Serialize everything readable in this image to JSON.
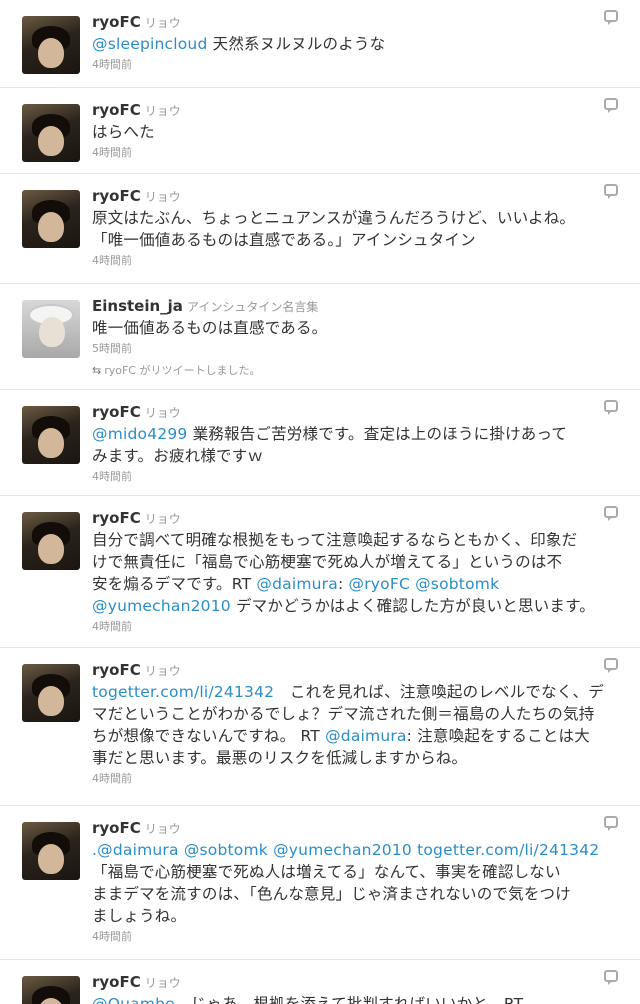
{
  "tweets": [
    {
      "user": "ryoFC",
      "name": "リョウ",
      "parts": [
        {
          "t": "@sleepincloud",
          "link": true
        },
        {
          "t": " 天然系ヌルヌルのような"
        }
      ],
      "time": "4時間前"
    },
    {
      "user": "ryoFC",
      "name": "リョウ",
      "parts": [
        {
          "t": "はらへた"
        }
      ],
      "time": "4時間前"
    },
    {
      "user": "ryoFC",
      "name": "リョウ",
      "parts": [
        {
          "t": "原文はたぶん、ちょっとニュアンスが違うんだろうけど、いいよね。\n「唯一価値あるものは直感である。」アインシュタイン"
        }
      ],
      "time": "4時間前"
    },
    {
      "user": "Einstein_ja",
      "name": "アインシュタイン名言集",
      "parts": [
        {
          "t": "唯一価値あるものは直感である。"
        }
      ],
      "time": "5時間前",
      "retweet": "ryoFC がリツイートしました。"
    },
    {
      "user": "ryoFC",
      "name": "リョウ",
      "parts": [
        {
          "t": "@mido4299",
          "link": true
        },
        {
          "t": " 業務報告ご苦労様です。査定は上のほうに掛けあって\nみます。お疲れ様ですｗ"
        }
      ],
      "time": "4時間前"
    },
    {
      "user": "ryoFC",
      "name": "リョウ",
      "parts": [
        {
          "t": "自分で調べて明確な根拠をもって注意喚起するならともかく、印象だ\nけで無責任に「福島で心筋梗塞で死ぬ人が増えてる」というのは不\n安を煽るデマです。RT "
        },
        {
          "t": "@daimura",
          "link": true
        },
        {
          "t": ": "
        },
        {
          "t": "@ryoFC",
          "link": true
        },
        {
          "t": " "
        },
        {
          "t": "@sobtomk",
          "link": true
        },
        {
          "t": "\n"
        },
        {
          "t": "@yumechan2010",
          "link": true
        },
        {
          "t": " デマかどうかはよく確認した方が良いと思います。"
        }
      ],
      "time": "4時間前"
    },
    {
      "user": "ryoFC",
      "name": "リョウ",
      "parts": [
        {
          "t": "togetter.com/li/241342",
          "link": true
        },
        {
          "t": "　これを見れば、注意喚起のレベルでなく、デ\nマだということがわかるでしょ？デマ流された側＝福島の人たちの気持\nちが想像できないんですね。 RT "
        },
        {
          "t": "@daimura",
          "link": true
        },
        {
          "t": ": 注意喚起をすることは大\n事だと思います。最悪のリスクを低減しますからね。"
        }
      ],
      "time": "4時間前"
    },
    {
      "user": "ryoFC",
      "name": "リョウ",
      "parts": [
        {
          "t": ".@daimura",
          "link": true
        },
        {
          "t": " "
        },
        {
          "t": "@sobtomk",
          "link": true
        },
        {
          "t": " "
        },
        {
          "t": "@yumechan2010",
          "link": true
        },
        {
          "t": " "
        },
        {
          "t": "togetter.com/li/241342",
          "link": true
        },
        {
          "t": "\n「福島で心筋梗塞で死ぬ人は増えてる」なんて、事実を確認しない\nままデマを流すのは、「色んな意見」じゃ済まされないので気をつけ\nましょうね。"
        }
      ],
      "time": "4時間前"
    },
    {
      "user": "ryoFC",
      "name": "リョウ",
      "parts": [
        {
          "t": "@Quambe",
          "link": true
        },
        {
          "t": "　じゃあ、根拠を添えて批判すればいいかと。RT"
        }
      ],
      "time": ""
    }
  ]
}
